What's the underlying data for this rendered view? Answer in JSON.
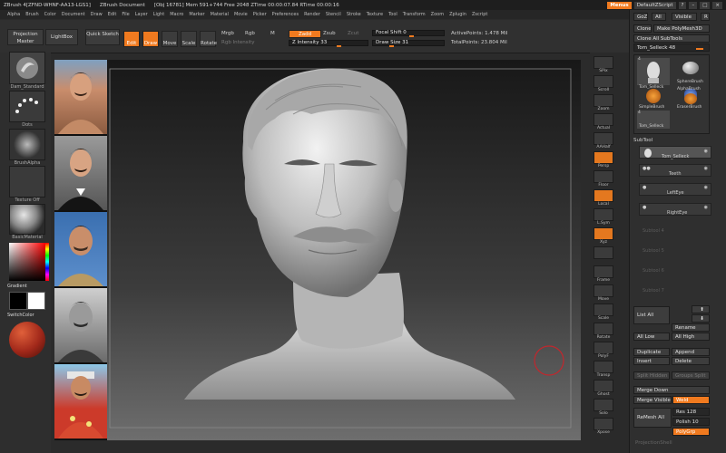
{
  "titlebar": {
    "app": "ZBrush 4[ZFND-WHNF-AA13-LGS1]",
    "doc": "ZBrush Document",
    "stats": "[Obj 16781] Mem 591+744 Free 2048 ZTime 00:00:07.84 RTime 00:00:16",
    "menus_btn": "Menus",
    "script": "DefaultZScript",
    "help": "?"
  },
  "menubar": [
    "Alpha",
    "Brush",
    "Color",
    "Document",
    "Draw",
    "Edit",
    "File",
    "Layer",
    "Light",
    "Macro",
    "Marker",
    "Material",
    "Movie",
    "Picker",
    "Preferences",
    "Render",
    "Stencil",
    "Stroke",
    "Texture",
    "Tool",
    "Transform",
    "Zoom",
    "Zplugin",
    "Zscript"
  ],
  "toolbar": {
    "projection_master": "Projection Master",
    "lightbox": "LightBox",
    "quick_sketch": "Quick Sketch",
    "edit": "Edit",
    "draw": "Draw",
    "move": "Move",
    "scale": "Scale",
    "rotate": "Rotate",
    "mrgb": "Mrgb",
    "rgb": "Rgb",
    "m": "M",
    "rgb_intensity": "Rgb Intensity",
    "zadd": "Zadd",
    "zsub": "Zsub",
    "zcut": "Zcut",
    "z_intensity": "Z Intensity 33",
    "focal_shift": "Focal Shift 0",
    "draw_size": "Draw Size 31",
    "active_points": "ActivePoints: 1.478 Mil",
    "total_points": "TotalPoints: 23.804 Mil"
  },
  "leftshelf": {
    "brush": "Dam_Standard",
    "stroke": "Dots",
    "alpha": "BrushAlpha",
    "texture": "Texture Off",
    "material": "BasicMaterial",
    "gradient": "Gradient",
    "switch_color": "SwitchColor"
  },
  "rightshelf": [
    "SPix",
    "Scroll",
    "Zoom",
    "Actual",
    "AAHalf",
    "Persp",
    "Floor",
    "Local",
    "L.Sym",
    "Xyz",
    "",
    "Frame",
    "Move",
    "Scale",
    "Rotate",
    "PolyF",
    "Transp",
    "Ghost",
    "Solo",
    "Xpose"
  ],
  "palette": {
    "goz": "GoZ",
    "all": "All",
    "visible": "Visible",
    "r": "R",
    "clone": "Clone",
    "make_polymesh": "Make PolyMesh3D",
    "clone_all": "Clone All SubTools",
    "tool_name": "Tom_Selleck 48",
    "tools": [
      {
        "name": "Tom_Selleck",
        "count": "4"
      },
      {
        "name": "SphereBrush",
        "count": ""
      },
      {
        "name": "AlphaBrush",
        "count": ""
      },
      {
        "name": "SimpleBrush",
        "count": ""
      },
      {
        "name": "EraserBrush",
        "count": ""
      },
      {
        "name": "Tom_Selleck",
        "count": "4"
      }
    ],
    "subtool_header": "SubTool",
    "subtools": [
      "Tom_Selleck",
      "Teeth",
      "LeftEye",
      "RightEye"
    ],
    "empty_slots": [
      "Subtool 4",
      "Subtool 5",
      "Subtool 6",
      "Subtool 7"
    ],
    "list_all": "List All",
    "rename": "Rename",
    "all_low": "All Low",
    "all_high": "All High",
    "duplicate": "Duplicate",
    "append": "Append",
    "insert": "Insert",
    "delete": "Delete",
    "split_hidden": "Split Hidden",
    "groups_split": "Groups Split",
    "merge_down": "Merge Down",
    "merge_visible": "Merge Visible",
    "weld": "Weld",
    "remesh_all": "ReMesh All",
    "res": "Res 128",
    "polish": "Polish 10",
    "polygrp": "PolyGrp",
    "projection": "ProjectionShell"
  },
  "colors": {
    "accent": "#f07a1f",
    "main_color": "#ffffff",
    "secondary_color": "#000000"
  }
}
